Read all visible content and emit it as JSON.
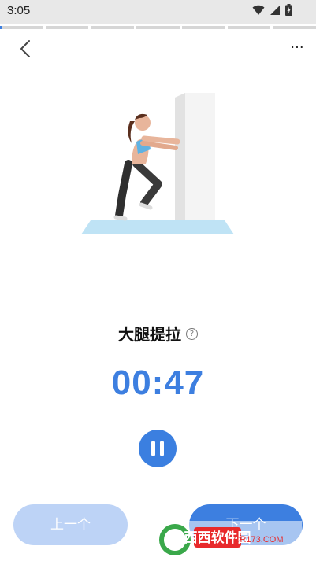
{
  "status_bar": {
    "time": "3:05"
  },
  "progress": {
    "segments": 7,
    "current_fill_fraction": 0.06
  },
  "header": {
    "back_icon": "chevron-left-icon",
    "more_label": "···"
  },
  "exercise": {
    "name": "大腿提拉",
    "help_icon": "question-circle-icon"
  },
  "timer": {
    "value": "00:47"
  },
  "controls": {
    "pause_icon": "pause-icon"
  },
  "footer": {
    "prev_label": "上一个",
    "next_label": "下一个"
  },
  "watermark": {
    "text": "西西软件园",
    "sub": "CR173.COM"
  },
  "colors": {
    "accent": "#3d7fe0",
    "prev_bg": "#bdd3f6"
  }
}
